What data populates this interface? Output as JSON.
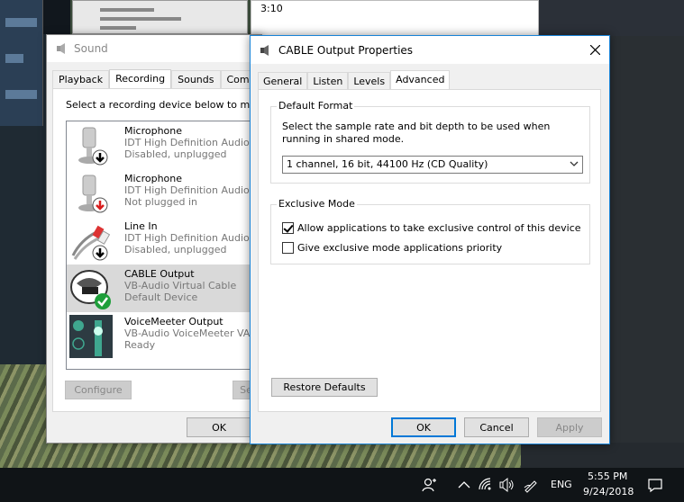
{
  "background": {
    "snippet_text": "3:10"
  },
  "sound_window": {
    "title": "Sound",
    "tabs": [
      "Playback",
      "Recording",
      "Sounds",
      "Communica"
    ],
    "active_tab": 1,
    "hint": "Select a recording device below to modi",
    "devices": [
      {
        "name": "Microphone",
        "line2": "IDT High Definition Audio C",
        "line3": "Disabled, unplugged",
        "icon": "microphone-icon",
        "badge": "down-arrow-black"
      },
      {
        "name": "Microphone",
        "line2": "IDT High Definition Audio C",
        "line3": "Not plugged in",
        "icon": "microphone-icon",
        "badge": "down-arrow-red"
      },
      {
        "name": "Line In",
        "line2": "IDT High Definition Audio C",
        "line3": "Disabled, unplugged",
        "icon": "line-in-cable-icon",
        "badge": "down-arrow-black"
      },
      {
        "name": "CABLE Output",
        "line2": "VB-Audio Virtual Cable",
        "line3": "Default Device",
        "icon": "cable-icon",
        "badge": "check-green"
      },
      {
        "name": "VoiceMeeter Output",
        "line2": "VB-Audio VoiceMeeter VAIO",
        "line3": "Ready",
        "icon": "voicemeeter-icon",
        "badge": "none"
      }
    ],
    "configure_label": "Configure",
    "set_label": "Se",
    "ok_label": "OK"
  },
  "props_window": {
    "title": "CABLE Output Properties",
    "tabs": [
      "General",
      "Listen",
      "Levels",
      "Advanced"
    ],
    "active_tab": 3,
    "default_format": {
      "label": "Default Format",
      "description": "Select the sample rate and bit depth to be used when running in shared mode.",
      "selected": "1 channel, 16 bit, 44100 Hz (CD Quality)"
    },
    "exclusive_mode": {
      "label": "Exclusive Mode",
      "option1": "Allow applications to take exclusive control of this device",
      "option1_checked": true,
      "option2": "Give exclusive mode applications priority",
      "option2_checked": false
    },
    "restore_label": "Restore Defaults",
    "ok_label": "OK",
    "cancel_label": "Cancel",
    "apply_label": "Apply"
  },
  "taskbar": {
    "language": "ENG",
    "time": "5:55 PM",
    "date": "9/24/2018"
  },
  "colors": {
    "accent": "#0078d7",
    "selected_row": "#d9d9d9",
    "check_green": "#1e9e3a",
    "arrow_red": "#d81e1e"
  }
}
